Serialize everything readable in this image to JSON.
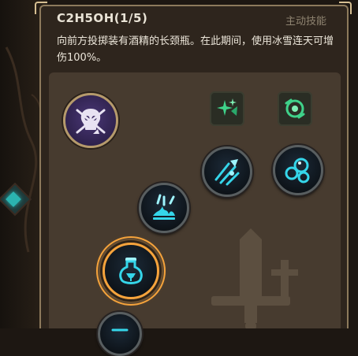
{
  "tooltip": {
    "title": "C2H5OH(1/5)",
    "type_label": "主动技能",
    "description": "向前方投掷装有酒精的长颈瓶。在此期间，使用冰雪连天可增伤100%。"
  },
  "skill_tree": {
    "main_skill": {
      "icon": "skull-bone-icon"
    },
    "passive_slots": [
      {
        "icon": "sparkle-wing-icon"
      },
      {
        "icon": "shield-eye-icon"
      }
    ],
    "nodes": [
      {
        "icon": "claw-slash-icon"
      },
      {
        "icon": "bubble-orbs-icon"
      },
      {
        "icon": "splash-impact-icon"
      },
      {
        "icon": "flask-bottle-icon",
        "selected": true
      },
      {
        "icon": "partial-node-icon"
      }
    ]
  },
  "colors": {
    "accent_selected": "#f5a33c",
    "icon_cyan": "#35d6ea",
    "icon_green": "#3fd28a",
    "panel_bg": "#2e251d",
    "tree_bg": "#473b2f"
  }
}
